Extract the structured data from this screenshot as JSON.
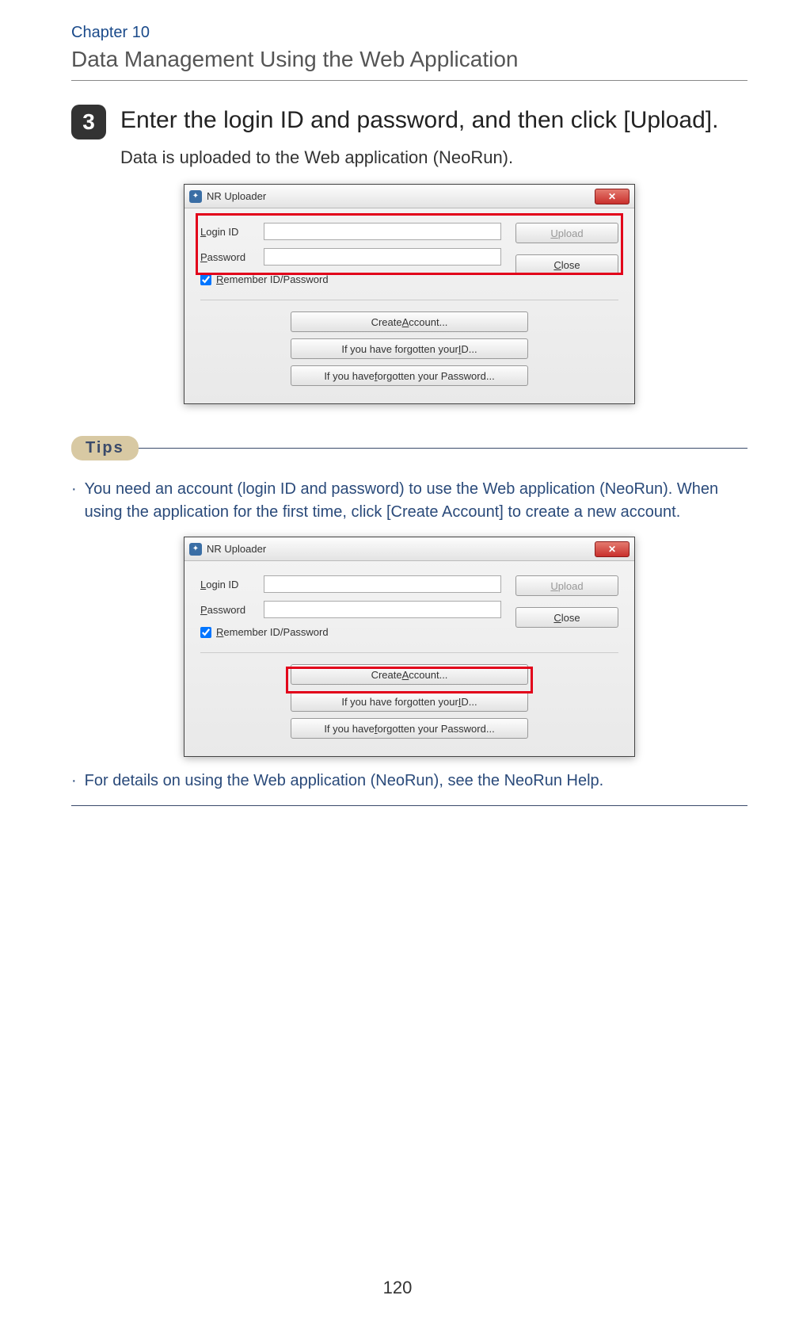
{
  "chapter": {
    "label": "Chapter 10",
    "title": "Data Management Using the Web Application"
  },
  "step": {
    "number": "3",
    "heading": "Enter the login ID and password, and then click [Upload].",
    "sub": "Data is uploaded to the Web application (NeoRun)."
  },
  "dialog": {
    "title": "NR Uploader",
    "close_glyph": "✕",
    "login_label_pre": "L",
    "login_label_post": "ogin ID",
    "password_label_pre": "P",
    "password_label_post": "assword",
    "remember_pre": "R",
    "remember_post": "emember ID/Password",
    "upload_pre": "U",
    "upload_post": "pload",
    "close_pre": "C",
    "close_post": "lose",
    "create_pre": "Create ",
    "create_u": "A",
    "create_post": "ccount...",
    "forgot_id_pre": "If you have forgotten your ",
    "forgot_id_u": "I",
    "forgot_id_post": "D...",
    "forgot_pw_pre": "If you have ",
    "forgot_pw_u": "f",
    "forgot_pw_post": "orgotten your Password..."
  },
  "tips": {
    "label": "Tips",
    "items": [
      "You need an account (login ID and password) to use the Web application (NeoRun). When using the application for the first time, click [Create Account] to create a new account.",
      "For details on using the Web application (NeoRun), see the NeoRun Help."
    ]
  },
  "page_number": "120"
}
